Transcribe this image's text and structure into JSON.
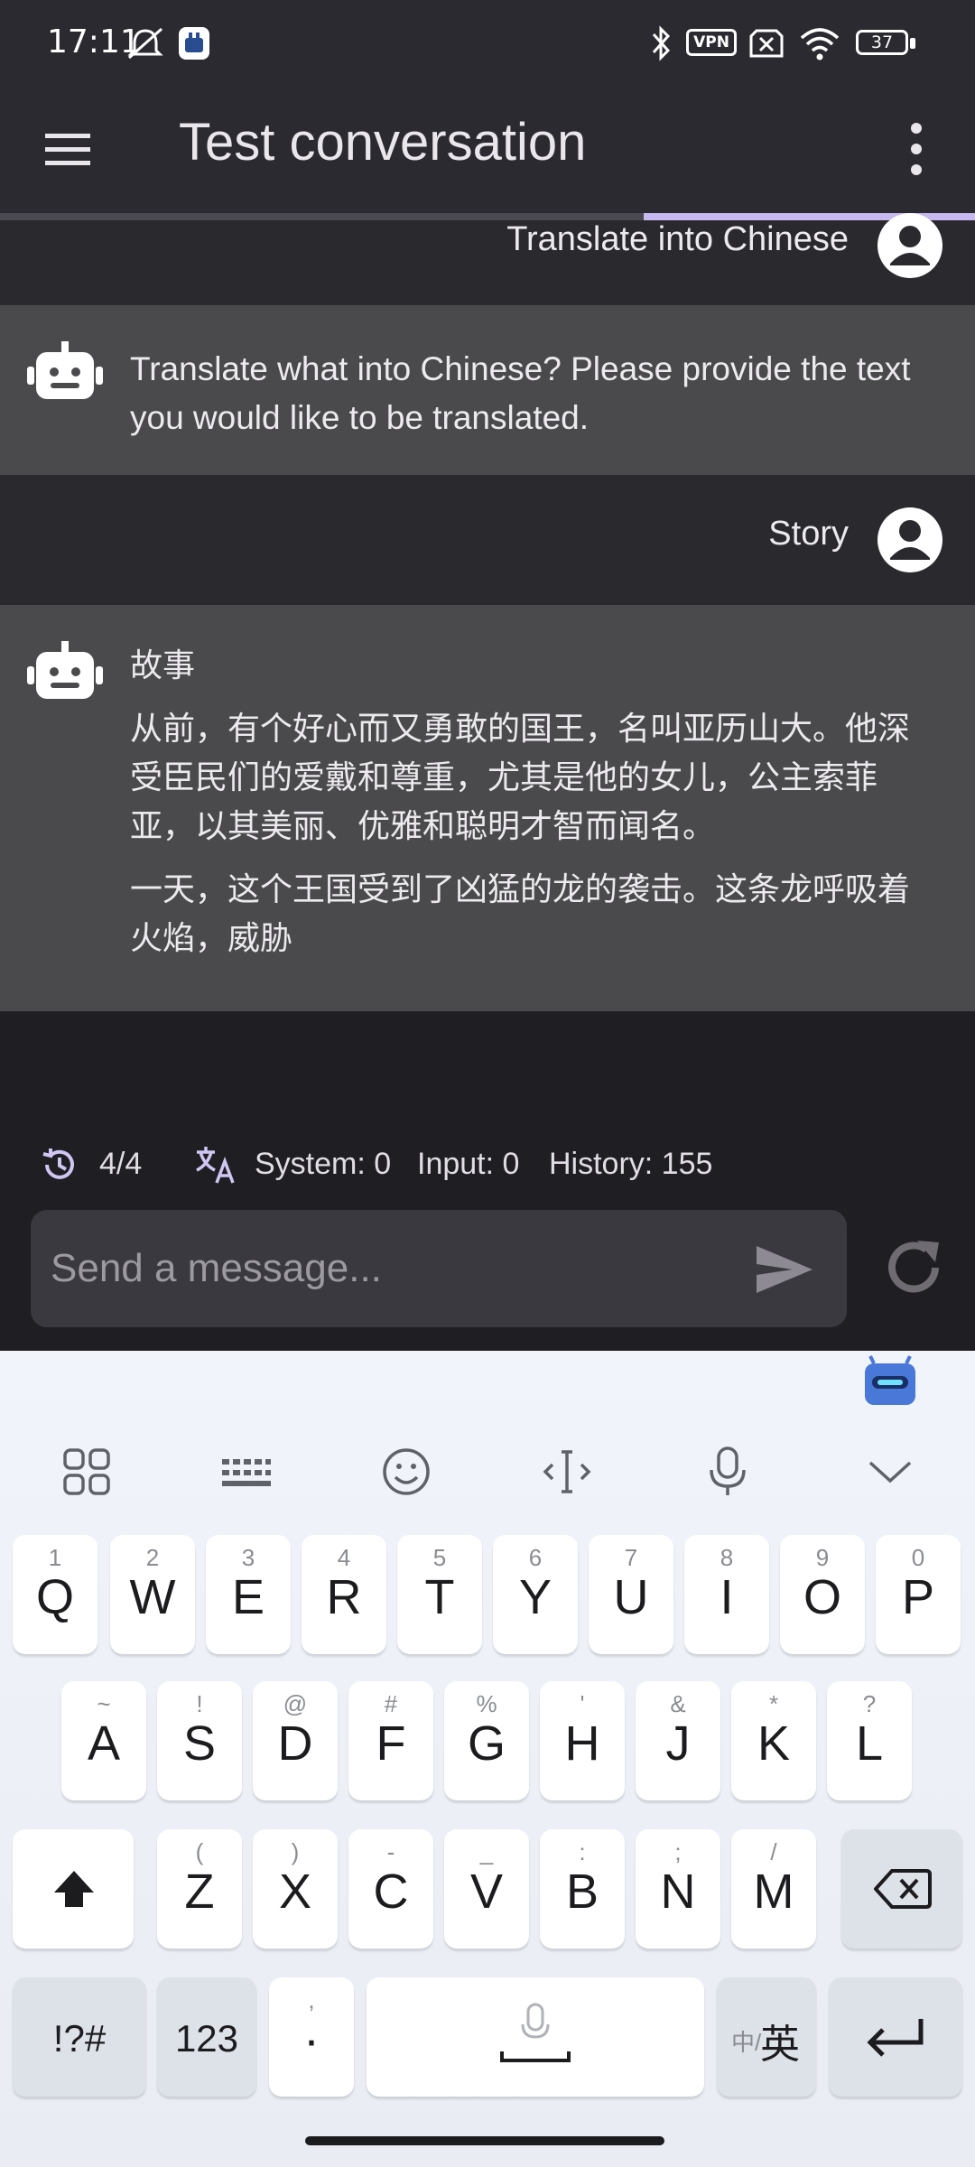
{
  "status_bar": {
    "time": "17:11",
    "vpn_label": "VPN",
    "battery": "37",
    "icons": [
      "muted-bell-icon",
      "app-icon",
      "bluetooth-icon",
      "vpn-icon",
      "no-sim-icon",
      "wifi-icon",
      "battery-icon"
    ]
  },
  "app_bar": {
    "title": "Test conversation",
    "loading_progress": 0.34
  },
  "messages": [
    {
      "role": "user",
      "text": "Translate into Chinese"
    },
    {
      "role": "assistant",
      "paragraphs": [
        "Translate what into Chinese? Please provide the text you would like to be translated."
      ]
    },
    {
      "role": "user",
      "text": "Story"
    },
    {
      "role": "assistant",
      "paragraphs": [
        "故事",
        "从前，有个好心而又勇敢的国王，名叫亚历山大。他深受臣民们的爱戴和尊重，尤其是他的女儿，公主索菲亚，以其美丽、优雅和聪明才智而闻名。",
        "一天，这个王国受到了凶猛的龙的袭击。这条龙呼吸着火焰，威胁"
      ]
    }
  ],
  "stats": {
    "history_count": "4/4",
    "system": "System: 0",
    "input": "Input: 0",
    "history": "History: 155"
  },
  "composer": {
    "placeholder": "Send a message..."
  },
  "keyboard": {
    "toolbar": [
      "grid-icon",
      "keyboard-icon",
      "emoji-icon",
      "cursor-icon",
      "mic-icon",
      "collapse-chevron-icon"
    ],
    "row1": [
      [
        "Q",
        "1"
      ],
      [
        "W",
        "2"
      ],
      [
        "E",
        "3"
      ],
      [
        "R",
        "4"
      ],
      [
        "T",
        "5"
      ],
      [
        "Y",
        "6"
      ],
      [
        "U",
        "7"
      ],
      [
        "I",
        "8"
      ],
      [
        "O",
        "9"
      ],
      [
        "P",
        "0"
      ]
    ],
    "row2": [
      [
        "A",
        "~"
      ],
      [
        "S",
        "!"
      ],
      [
        "D",
        "@"
      ],
      [
        "F",
        "#"
      ],
      [
        "G",
        "%"
      ],
      [
        "H",
        "'"
      ],
      [
        "J",
        "&"
      ],
      [
        "K",
        "*"
      ],
      [
        "L",
        "?"
      ]
    ],
    "row3": [
      [
        "Z",
        "("
      ],
      [
        "X",
        ")"
      ],
      [
        "C",
        "-"
      ],
      [
        "V",
        "_"
      ],
      [
        "B",
        ":"
      ],
      [
        "N",
        ";"
      ],
      [
        "M",
        "/"
      ]
    ],
    "symbols_key": "!?#",
    "numbers_key": "123",
    "punct_key_main": "·",
    "punct_key_hint": ",",
    "lang_key_small": "中/",
    "lang_key_big": "英"
  },
  "colors": {
    "accent": "#c7b8f0",
    "bar_bg": "#2b2a30",
    "bot_bg": "#4a4a4c"
  }
}
